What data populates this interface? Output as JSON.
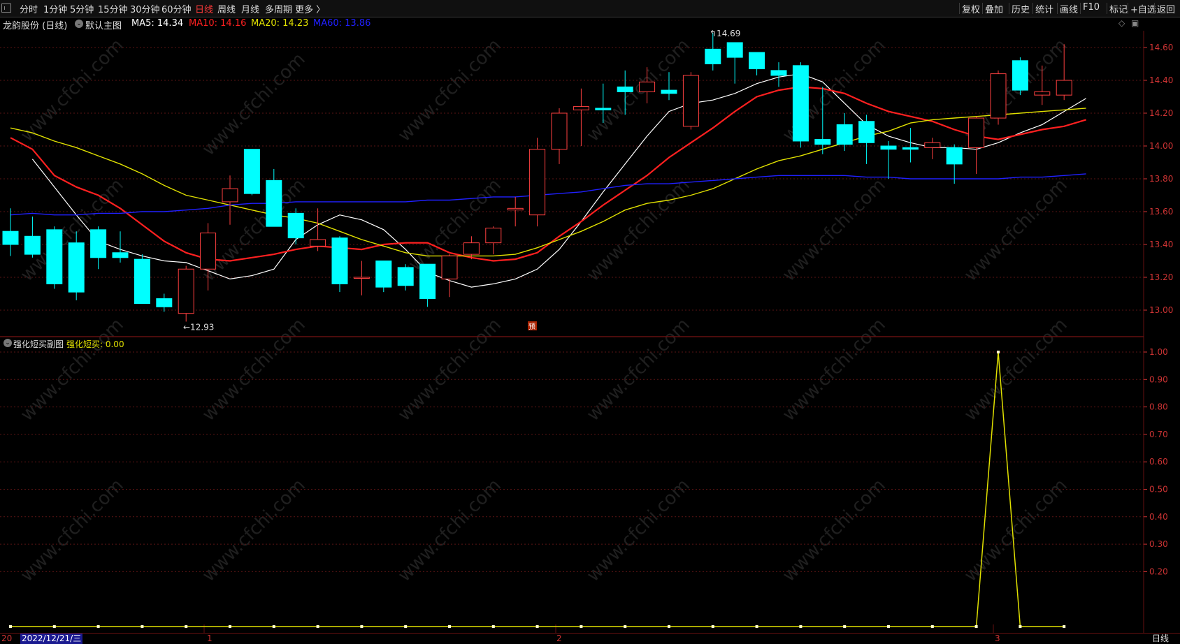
{
  "toolbar": {
    "left": [
      "分时",
      "1分钟",
      "5分钟",
      "15分钟",
      "30分钟",
      "60分钟",
      "日线",
      "周线",
      "月线",
      "多周期",
      "更多 〉"
    ],
    "active": "日线",
    "right": [
      "复权",
      "叠加",
      "历史",
      "统计",
      "画线",
      "F10",
      "标记",
      "+自选",
      "返回"
    ]
  },
  "main_info": {
    "stock": "龙韵股份 (日线)",
    "template": "默认主图",
    "ma5": "MA5: 14.34",
    "ma10": "MA10: 14.16",
    "ma20": "MA20: 14.23",
    "ma60": "MA60: 13.86"
  },
  "sub_info": {
    "name": "强化短买副图",
    "value": "强化短买: 0.00"
  },
  "colors": {
    "ma5": "#ffffff",
    "ma10": "#ff2020",
    "ma20": "#e0e000",
    "ma60": "#2020ff",
    "up": "#ff4040",
    "down": "#00ffff",
    "axis": "#cc3333",
    "indicator": "#e0e000"
  },
  "bottom": {
    "date": "2022/12/21/三",
    "left_cut": "20",
    "ticks": [
      "1",
      "2",
      "3"
    ],
    "period": "日线"
  },
  "markers": {
    "high_label": "14.69",
    "low_label": "12.93",
    "pre_mark": "预"
  },
  "watermark": "www.cfchi.com",
  "chart_data": [
    {
      "type": "candlestick",
      "title": "龙韵股份 (日线)",
      "ylim": [
        12.9,
        14.72
      ],
      "y_ticks": [
        "14.60",
        "14.40",
        "14.20",
        "14.00",
        "13.80",
        "13.60",
        "13.40",
        "13.20",
        "13.00"
      ],
      "candles": [
        {
          "o": 13.48,
          "h": 13.62,
          "l": 13.33,
          "c": 13.4
        },
        {
          "o": 13.45,
          "h": 13.57,
          "l": 13.32,
          "c": 13.34
        },
        {
          "o": 13.49,
          "h": 13.51,
          "l": 13.13,
          "c": 13.16
        },
        {
          "o": 13.41,
          "h": 13.48,
          "l": 13.06,
          "c": 13.11
        },
        {
          "o": 13.49,
          "h": 13.51,
          "l": 13.25,
          "c": 13.32
        },
        {
          "o": 13.35,
          "h": 13.48,
          "l": 13.29,
          "c": 13.32
        },
        {
          "o": 13.31,
          "h": 13.34,
          "l": 13.04,
          "c": 13.04
        },
        {
          "o": 13.07,
          "h": 13.1,
          "l": 12.99,
          "c": 13.02
        },
        {
          "o": 12.98,
          "h": 13.27,
          "l": 12.93,
          "c": 13.25
        },
        {
          "o": 13.25,
          "h": 13.53,
          "l": 13.12,
          "c": 13.47
        },
        {
          "o": 13.66,
          "h": 13.82,
          "l": 13.52,
          "c": 13.74
        },
        {
          "o": 13.98,
          "h": 13.98,
          "l": 13.7,
          "c": 13.71
        },
        {
          "o": 13.79,
          "h": 13.86,
          "l": 13.57,
          "c": 13.51
        },
        {
          "o": 13.59,
          "h": 13.62,
          "l": 13.4,
          "c": 13.44
        },
        {
          "o": 13.39,
          "h": 13.62,
          "l": 13.36,
          "c": 13.43
        },
        {
          "o": 13.44,
          "h": 13.45,
          "l": 13.11,
          "c": 13.16
        },
        {
          "o": 13.2,
          "h": 13.3,
          "l": 13.09,
          "c": 13.2
        },
        {
          "o": 13.3,
          "h": 13.3,
          "l": 13.11,
          "c": 13.14
        },
        {
          "o": 13.26,
          "h": 13.28,
          "l": 13.12,
          "c": 13.15
        },
        {
          "o": 13.28,
          "h": 13.28,
          "l": 13.02,
          "c": 13.07
        },
        {
          "o": 13.19,
          "h": 13.34,
          "l": 13.08,
          "c": 13.33
        },
        {
          "o": 13.34,
          "h": 13.45,
          "l": 13.31,
          "c": 13.41
        },
        {
          "o": 13.41,
          "h": 13.51,
          "l": 13.34,
          "c": 13.5
        },
        {
          "o": 13.61,
          "h": 13.69,
          "l": 13.51,
          "c": 13.62
        },
        {
          "o": 13.58,
          "h": 14.05,
          "l": 13.51,
          "c": 13.98
        },
        {
          "o": 13.98,
          "h": 14.23,
          "l": 13.89,
          "c": 14.2
        },
        {
          "o": 14.22,
          "h": 14.35,
          "l": 14.0,
          "c": 14.24
        },
        {
          "o": 14.23,
          "h": 14.38,
          "l": 14.14,
          "c": 14.22
        },
        {
          "o": 14.36,
          "h": 14.46,
          "l": 14.19,
          "c": 14.33
        },
        {
          "o": 14.33,
          "h": 14.48,
          "l": 14.26,
          "c": 14.39
        },
        {
          "o": 14.34,
          "h": 14.45,
          "l": 14.28,
          "c": 14.32
        },
        {
          "o": 14.12,
          "h": 14.45,
          "l": 14.1,
          "c": 14.43
        },
        {
          "o": 14.59,
          "h": 14.69,
          "l": 14.46,
          "c": 14.5
        },
        {
          "o": 14.63,
          "h": 14.63,
          "l": 14.38,
          "c": 14.54
        },
        {
          "o": 14.57,
          "h": 14.57,
          "l": 14.43,
          "c": 14.47
        },
        {
          "o": 14.46,
          "h": 14.51,
          "l": 14.36,
          "c": 14.43
        },
        {
          "o": 14.49,
          "h": 14.51,
          "l": 13.99,
          "c": 14.03
        },
        {
          "o": 14.04,
          "h": 14.36,
          "l": 13.95,
          "c": 14.01
        },
        {
          "o": 14.13,
          "h": 14.2,
          "l": 13.97,
          "c": 14.01
        },
        {
          "o": 14.15,
          "h": 14.19,
          "l": 13.89,
          "c": 14.02
        },
        {
          "o": 14.0,
          "h": 14.03,
          "l": 13.8,
          "c": 13.98
        },
        {
          "o": 13.99,
          "h": 14.11,
          "l": 13.9,
          "c": 13.98
        },
        {
          "o": 13.99,
          "h": 14.05,
          "l": 13.92,
          "c": 14.02
        },
        {
          "o": 13.99,
          "h": 14.01,
          "l": 13.77,
          "c": 13.89
        },
        {
          "o": 13.99,
          "h": 14.18,
          "l": 13.83,
          "c": 14.17
        },
        {
          "o": 14.17,
          "h": 14.46,
          "l": 14.13,
          "c": 14.44
        },
        {
          "o": 14.52,
          "h": 14.54,
          "l": 14.31,
          "c": 14.34
        },
        {
          "o": 14.31,
          "h": 14.49,
          "l": 14.25,
          "c": 14.33
        },
        {
          "o": 14.31,
          "h": 14.62,
          "l": 14.28,
          "c": 14.4
        }
      ],
      "series": [
        {
          "name": "MA5",
          "values": [
            13.92,
            13.75,
            13.58,
            13.42,
            13.37,
            13.33,
            13.3,
            13.29,
            13.24,
            13.19,
            13.21,
            13.25,
            13.43,
            13.52,
            13.58,
            13.55,
            13.49,
            13.37,
            13.23,
            13.18,
            13.14,
            13.16,
            13.19,
            13.25,
            13.37,
            13.54,
            13.72,
            13.89,
            14.06,
            14.21,
            14.26,
            14.28,
            14.32,
            14.38,
            14.42,
            14.44,
            14.39,
            14.26,
            14.13,
            14.06,
            14.02,
            13.99,
            13.99,
            13.98,
            14.02,
            14.08,
            14.13,
            14.21,
            14.29
          ]
        },
        {
          "name": "MA10",
          "values": [
            14.05,
            13.98,
            13.82,
            13.75,
            13.7,
            13.62,
            13.52,
            13.42,
            13.35,
            13.31,
            13.3,
            13.32,
            13.34,
            13.37,
            13.39,
            13.38,
            13.37,
            13.4,
            13.41,
            13.41,
            13.35,
            13.32,
            13.3,
            13.31,
            13.35,
            13.45,
            13.54,
            13.64,
            13.73,
            13.82,
            13.93,
            14.02,
            14.11,
            14.21,
            14.3,
            14.34,
            14.36,
            14.35,
            14.32,
            14.26,
            14.21,
            14.18,
            14.15,
            14.1,
            14.06,
            14.04,
            14.07,
            14.1,
            14.12,
            14.16
          ]
        },
        {
          "name": "MA20",
          "values": [
            14.11,
            14.08,
            14.03,
            13.99,
            13.94,
            13.89,
            13.83,
            13.76,
            13.7,
            13.67,
            13.64,
            13.61,
            13.58,
            13.56,
            13.53,
            13.48,
            13.43,
            13.39,
            13.35,
            13.33,
            13.33,
            13.33,
            13.33,
            13.34,
            13.38,
            13.43,
            13.48,
            13.54,
            13.61,
            13.65,
            13.67,
            13.7,
            13.74,
            13.8,
            13.86,
            13.91,
            13.94,
            13.98,
            14.02,
            14.06,
            14.09,
            14.14,
            14.16,
            14.17,
            14.18,
            14.19,
            14.2,
            14.21,
            14.22,
            14.23
          ]
        },
        {
          "name": "MA60",
          "values": [
            13.58,
            13.59,
            13.58,
            13.58,
            13.59,
            13.59,
            13.6,
            13.6,
            13.61,
            13.62,
            13.64,
            13.65,
            13.65,
            13.66,
            13.66,
            13.66,
            13.66,
            13.66,
            13.66,
            13.67,
            13.67,
            13.68,
            13.69,
            13.69,
            13.7,
            13.71,
            13.72,
            13.74,
            13.76,
            13.77,
            13.77,
            13.78,
            13.79,
            13.8,
            13.81,
            13.82,
            13.82,
            13.82,
            13.82,
            13.81,
            13.81,
            13.8,
            13.8,
            13.8,
            13.8,
            13.8,
            13.81,
            13.81,
            13.82,
            13.83
          ]
        }
      ]
    },
    {
      "type": "line",
      "title": "强化短买副图",
      "ylim": [
        0,
        1.0
      ],
      "y_ticks": [
        "1.00",
        "0.90",
        "0.80",
        "0.70",
        "0.60",
        "0.50",
        "0.40",
        "0.30",
        "0.20"
      ],
      "series": [
        {
          "name": "强化短买",
          "values": [
            0,
            0,
            0,
            0,
            0,
            0,
            0,
            0,
            0,
            0,
            0,
            0,
            0,
            0,
            0,
            0,
            0,
            0,
            0,
            0,
            0,
            0,
            0,
            0,
            0,
            0,
            0,
            0,
            0,
            0,
            0,
            0,
            0,
            0,
            0,
            0,
            0,
            0,
            0,
            0,
            0,
            0,
            0,
            0,
            0,
            1,
            0,
            0,
            0
          ]
        }
      ]
    }
  ]
}
